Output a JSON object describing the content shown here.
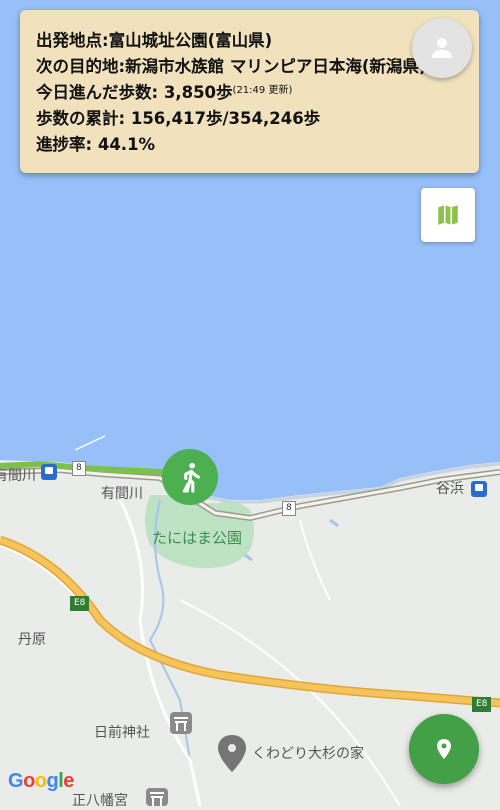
{
  "info": {
    "origin_label": "出発地点:",
    "origin_value": "富山城址公園(富山県)",
    "next_label": "次の目的地:",
    "next_value": "新潟市水族館 マリンピア日本海(新潟県)",
    "today_label": "今日進んだ歩数: ",
    "today_value": "3,850歩",
    "today_updated": "(21:49 更新)",
    "total_label": "歩数の累計: ",
    "total_value": "156,417歩/354,246歩",
    "progress_label": "進捗率: ",
    "progress_value": "44.1%"
  },
  "map": {
    "labels": {
      "arima_left": "有間川",
      "arima": "有間川",
      "park": "たにはま公園",
      "tanihama": "谷浜",
      "tanbara": "丹原",
      "shrine": "日前神社",
      "cedar": "くわどり大杉の家",
      "bottom": "正八幡宮"
    },
    "route_shields": {
      "r8_left": "8",
      "r8_mid": "8",
      "e8_left": "E8",
      "e8_right": "E8"
    },
    "attribution": "Google"
  },
  "icons": {
    "avatar": "person-icon",
    "map_toggle": "map-icon",
    "walker": "walking-person-icon",
    "fab": "location-pin-icon"
  },
  "colors": {
    "sea": "#97bff8",
    "card": "#f1e2bd",
    "green": "#4caf50",
    "highway": "#f6c45a",
    "route": "#7cc24a"
  }
}
